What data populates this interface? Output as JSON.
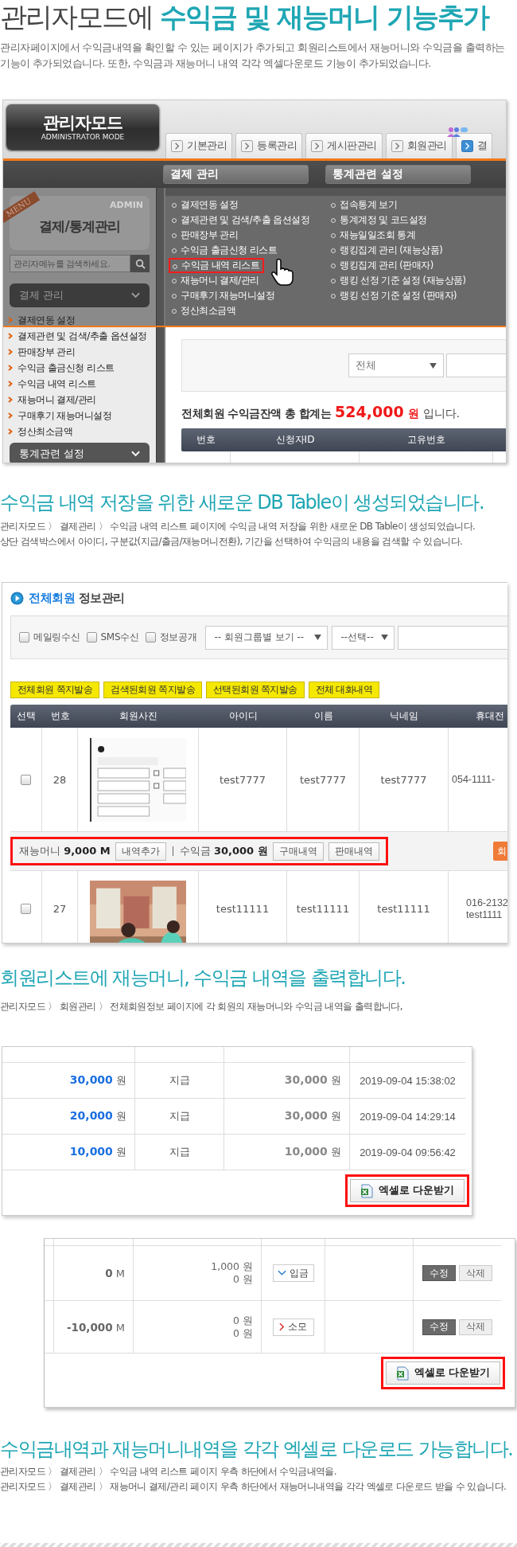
{
  "intro": {
    "title": "관리자모드에 **수익금 및 재능머니 기능추가**",
    "description": "관리자페이지에서 수익금내역을 확인할 수 있는 페이지가 추가되고 회원리스트에서 재능머니와 수익금을 출력하는 기능이 추가되었습니다. 또한, 수익금과 재능머니 내역 각각 엑셀다운로드 기능이 추가되었습니다."
  },
  "admin_screen": {
    "logo": {
      "title": "관리자모드",
      "subtitle": "ADMINISTRATOR MODE"
    },
    "tabs": [
      {
        "label": "기본관리",
        "selected": false
      },
      {
        "label": "등록관리",
        "selected": false
      },
      {
        "label": "게시판관리",
        "selected": false
      },
      {
        "label": "회원관리",
        "selected": false
      },
      {
        "label": "결",
        "selected": true
      }
    ],
    "menu_headers": [
      "결제 관리",
      "통계관련 설정"
    ],
    "dropdown_columns": [
      {
        "items": [
          {
            "label": "결제연동 설정",
            "highlighted": false
          },
          {
            "label": "결제관련 및 검색/추출 옵션설정",
            "highlighted": false
          },
          {
            "label": "판매장부 관리",
            "highlighted": false
          },
          {
            "label": "수익금 출금신청 리스트",
            "highlighted": false
          },
          {
            "label": "수익금 내역 리스트",
            "highlighted": true
          },
          {
            "label": "재능머니 결제/관리",
            "highlighted": false
          },
          {
            "label": "구매후기 재능머니설정",
            "highlighted": false
          },
          {
            "label": "정산최소금액",
            "highlighted": false
          }
        ]
      },
      {
        "items": [
          {
            "label": "접속통계 보기",
            "highlighted": false
          },
          {
            "label": "통계계정 및 코드설정",
            "highlighted": false
          },
          {
            "label": "재능일일조회 통계",
            "highlighted": false
          },
          {
            "label": "랭킹집계 관리 (재능상품)",
            "highlighted": false
          },
          {
            "label": "랭킹집계 관리 (판매자)",
            "highlighted": false
          },
          {
            "label": "랭킹 선정 기준 설정 (재능상품)",
            "highlighted": false
          },
          {
            "label": "랭킹 선정 기준 설정 (판매자)",
            "highlighted": false
          }
        ]
      }
    ],
    "sidebar": {
      "ribbon": "MENU",
      "watermark": "ADMIN",
      "title": "결제/통계관리",
      "search_placeholder": "관리자메뉴를 검색하세요.",
      "groups": [
        {
          "label": "결제 관리",
          "items": [
            "결제연동 설정",
            "결제관련 및 검색/추출 옵션설정",
            "판매장부 관리",
            "수익금 출금신청 리스트",
            "수익금 내역 리스트",
            "재능머니 결제/관리",
            "구매후기 재능머니설정",
            "정산최소금액"
          ]
        },
        {
          "label": "통계관련 설정"
        }
      ]
    },
    "content": {
      "select": "전체",
      "total_label": "전체회원 수익금잔액 총 합계는",
      "total_amount": "524,000",
      "total_unit": "원",
      "total_suffix": "입니다.",
      "columns": [
        "번호",
        "신청자ID",
        "고유번호"
      ]
    }
  },
  "section_2": {
    "heading": "수익금 내역 저장을 위한 새로운 DB Table이 생성되었습니다.",
    "lines": [
      "관리자모드 〉 결제관리 〉 수익금 내역 리스트 페이지에 수익금 내역 저장을 위한 새로운 DB Table이 생성되었습니다.",
      "상단 검색박스에서 아이디, 구분값(지급/출금/재능머니전환), 기간을 선택하여 수익금의 내용을 검색할 수 있습니다."
    ]
  },
  "member_screen": {
    "title": "**전체회원** 정보관리",
    "filters": [
      {
        "label": "메일링수신",
        "checked": false
      },
      {
        "label": "SMS수신",
        "checked": false
      },
      {
        "label": "정보공개",
        "checked": false
      }
    ],
    "selects": [
      "-- 회원그룹별 보기 --",
      "--선택--"
    ],
    "actions": [
      "전체회원 쪽지발송",
      "검색된회원 쪽지발송",
      "선택된회원 쪽지발송",
      "전체 대화내역"
    ],
    "columns": [
      "선택",
      "번호",
      "회원사진",
      "아이디",
      "이름",
      "닉네임",
      "휴대전"
    ],
    "rows": [
      {
        "checked": false,
        "number": "28",
        "id": "test7777",
        "name": "test7777",
        "nickname": "test7777",
        "phone": [
          "054-1111-"
        ],
        "summary": {
          "highlighted": true,
          "money": "재능머니 **9,000 M**",
          "add_button": "내역추가",
          "income": "수익금 **30,000 원**",
          "buttons": [
            "구매내역",
            "판매내역"
          ],
          "side_button": "회"
        }
      },
      {
        "checked": false,
        "number": "27",
        "id": "test11111",
        "name": "test11111",
        "nickname": "test11111",
        "phone": [
          "016-2132",
          "test1111"
        ]
      }
    ]
  },
  "section_3": {
    "heading": "회원리스트에 재능머니, 수익금 내역을 출력합니다.",
    "lines": [
      "관리자모드 〉 회원관리 〉 전체회원정보 페이지에 각 회원의 재능머니와 수익금 내역을 출력합니다,"
    ]
  },
  "income_screen": {
    "rows": [
      {
        "amount": "**30,000** 원",
        "type": "지급",
        "balance": "**30,000** 원",
        "date": "2019-09-04 15:38:02"
      },
      {
        "amount": "**20,000** 원",
        "type": "지급",
        "balance": "**30,000** 원",
        "date": "2019-09-04 14:29:14"
      },
      {
        "amount": "**10,000** 원",
        "type": "지급",
        "balance": "**10,000** 원",
        "date": "2019-09-04 09:56:42"
      }
    ],
    "download_button": {
      "label": "엑셀로 다운받기",
      "highlighted": true
    }
  },
  "money_screen": {
    "rows": [
      {
        "money": "**0** M",
        "income": "1,000 원",
        "income_sub": "0 원",
        "kind": "deposit",
        "badge": "입금",
        "edit": "수정",
        "delete": "삭제"
      },
      {
        "money": "**-10,000** M",
        "income": "0 원",
        "income_sub": "0 원",
        "kind": "use",
        "badge": "소모",
        "edit": "수정",
        "delete": "삭제"
      }
    ],
    "download_button": {
      "label": "엑셀로 다운받기",
      "highlighted": true
    }
  },
  "section_4": {
    "heading": "수익금내역과 재능머니내역을 각각 엑셀로 다운로드 가능합니다.",
    "lines": [
      "관리자모드 〉 결제관리 〉 수익금 내역 리스트 페이지 우측 하단에서 수익금내역을.",
      "관리자모드 〉 결제관리 〉 재능머니 결제/관리 페이지 우측 하단에서 재능머니내역을 각각 엑셀로 다운로드 받을 수 있습니다."
    ]
  }
}
